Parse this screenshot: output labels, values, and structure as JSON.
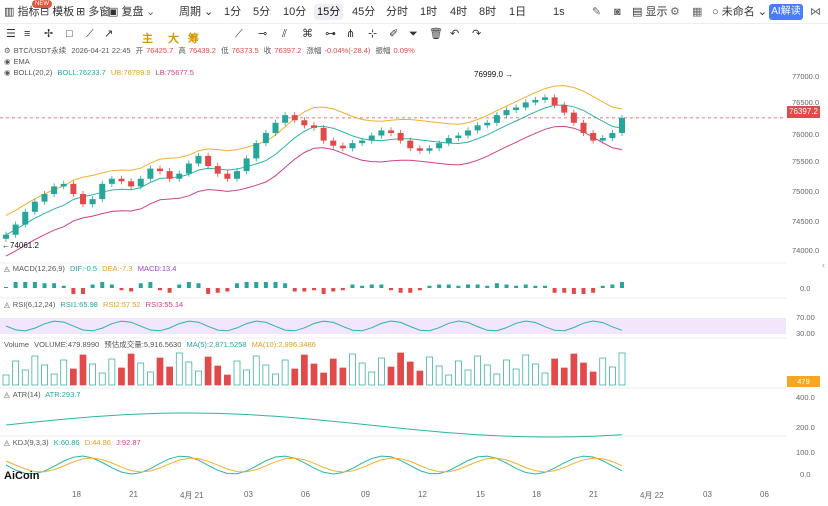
{
  "toolbar": {
    "indicators": "指标",
    "new_badge": "NEW",
    "template": "模板",
    "multi": "多窗",
    "replay": "复盘",
    "period": "周期",
    "intervals": [
      "1分",
      "5分",
      "10分",
      "15分",
      "45分",
      "分时",
      "1时",
      "4时",
      "8时",
      "1日"
    ],
    "active_interval": "15分",
    "seconds": "1s",
    "display": "显示",
    "unnamed": "未命名",
    "ai": "AI解读",
    "zhu": "主",
    "da": "大",
    "chou": "筹"
  },
  "info": {
    "pair": "BTC/USDT永续",
    "datetime": "2026-04-21 22:45",
    "open_label": "开",
    "open": "76425.7",
    "high_label": "高",
    "high": "76439.2",
    "low_label": "低",
    "low": "76373.5",
    "close_label": "收",
    "close": "76397.2",
    "change_label": "涨幅",
    "change": "-0.04%(-28.4)",
    "amp_label": "振幅",
    "amp": "0.09%",
    "ema": "EMA",
    "boll": "BOLL(20,2)",
    "boll_mid": "BOLL:76233.7",
    "boll_ub": "UB:76789.8",
    "boll_lb": "LB:75677.5",
    "macd": "MACD(12,26,9)",
    "dif": "DIF:-0.5",
    "dea": "DEA:-7.3",
    "macd_val": "MACD:13.4",
    "rsi": "RSI(6,12,24)",
    "rsi1": "RSI1:65.98",
    "rsi2": "RSI2:57.52",
    "rsi3": "RSI3:55.14",
    "volume": "Volume",
    "volume_val": "VOLUME:479.8990",
    "vol_forecast": "预估成交量:5,916.5630",
    "ma5": "MA(5):2,871.5258",
    "ma10": "MA(10):2,996.3486",
    "atr": "ATR(14)",
    "atr_val": "ATR:293.7",
    "kdj": "KDJ(9,3,3)",
    "k": "K:60.86",
    "d": "D:44.86",
    "j": "J:92.87"
  },
  "labels": {
    "high_mark": "76999.0",
    "low_mark": "74061.2",
    "logo": "AiCoin",
    "price_tag": "76397.2",
    "vol_tag": "479"
  },
  "yaxis": {
    "price": [
      "77000.0",
      "76500.0",
      "76000.0",
      "75500.0",
      "75000.0",
      "74500.0",
      "74000.0"
    ],
    "macd": [
      "0.0"
    ],
    "rsi": [
      "70.00",
      "30.00"
    ],
    "atr": [
      "400.0",
      "200.0"
    ],
    "kdj": [
      "100.0",
      "0.0"
    ]
  },
  "xaxis": [
    "18",
    "21",
    "4月 21",
    "03",
    "06",
    "09",
    "12",
    "15",
    "18",
    "21",
    "4月 22",
    "03",
    "06"
  ],
  "chart_data": {
    "type": "candlestick",
    "symbol": "BTC/USDT永续",
    "interval": "15分",
    "ylim": [
      73800,
      77200
    ],
    "close_series": [
      74100,
      74300,
      74550,
      74750,
      74900,
      75050,
      75100,
      74900,
      74700,
      74800,
      75100,
      75200,
      75150,
      75050,
      75200,
      75400,
      75350,
      75200,
      75300,
      75500,
      75650,
      75450,
      75300,
      75200,
      75350,
      75600,
      75900,
      76100,
      76300,
      76450,
      76350,
      76250,
      76200,
      75950,
      75850,
      75800,
      75900,
      75950,
      76050,
      76150,
      76100,
      75950,
      75800,
      75750,
      75800,
      75900,
      76000,
      76050,
      76150,
      76250,
      76300,
      76450,
      76550,
      76600,
      76700,
      76750,
      76800,
      76650,
      76500,
      76300,
      76100,
      75950,
      76000,
      76100,
      76397.2
    ],
    "high_mark": 76999.0,
    "low_mark": 74061.2,
    "last_price": 76397.2
  }
}
